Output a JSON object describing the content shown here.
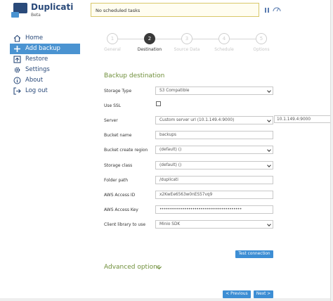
{
  "app": {
    "title": "Duplicati",
    "subtitle": "Beta"
  },
  "status": {
    "text": "No scheduled tasks"
  },
  "colors": {
    "accent": "#4a93d1",
    "brand": "#2a4a7a",
    "section": "#6f8f3a",
    "button": "#3d8ed4"
  },
  "nav": [
    {
      "label": "Home",
      "icon": "home-icon",
      "active": false
    },
    {
      "label": "Add backup",
      "icon": "plus-icon",
      "active": true
    },
    {
      "label": "Restore",
      "icon": "restore-icon",
      "active": false
    },
    {
      "label": "Settings",
      "icon": "gear-icon",
      "active": false
    },
    {
      "label": "About",
      "icon": "info-icon",
      "active": false
    },
    {
      "label": "Log out",
      "icon": "logout-icon",
      "active": false
    }
  ],
  "steps": [
    {
      "num": "1",
      "label": "General",
      "active": false
    },
    {
      "num": "2",
      "label": "Destination",
      "active": true
    },
    {
      "num": "3",
      "label": "Source Data",
      "active": false
    },
    {
      "num": "4",
      "label": "Schedule",
      "active": false
    },
    {
      "num": "5",
      "label": "Options",
      "active": false
    }
  ],
  "form": {
    "title": "Backup destination",
    "storage_type": {
      "label": "Storage Type",
      "value": "S3 Compatible"
    },
    "use_ssl": {
      "label": "Use SSL"
    },
    "server": {
      "label": "Server",
      "value": "Custom server url (10.1.149.4:9000)",
      "custom_value": "10.1.149.4:9000"
    },
    "bucket_name": {
      "label": "Bucket name",
      "value": "backups"
    },
    "bucket_region": {
      "label": "Bucket create region",
      "value": "(default) ()"
    },
    "storage_class": {
      "label": "Storage class",
      "value": "(default) ()"
    },
    "folder_path": {
      "label": "Folder path",
      "value": "/duplicati"
    },
    "access_id": {
      "label": "AWS Access ID",
      "value": "x2KwEe6563w0nES57vq9"
    },
    "access_key": {
      "label": "AWS Access Key",
      "value": "••••••••••••••••••••••••••••••••••••••••"
    },
    "client_library": {
      "label": "Client library to use",
      "value": "Minio SDK"
    },
    "test_button": "Test connection",
    "advanced": "Advanced options"
  },
  "footer": {
    "previous": "< Previous",
    "next": "Next >"
  }
}
